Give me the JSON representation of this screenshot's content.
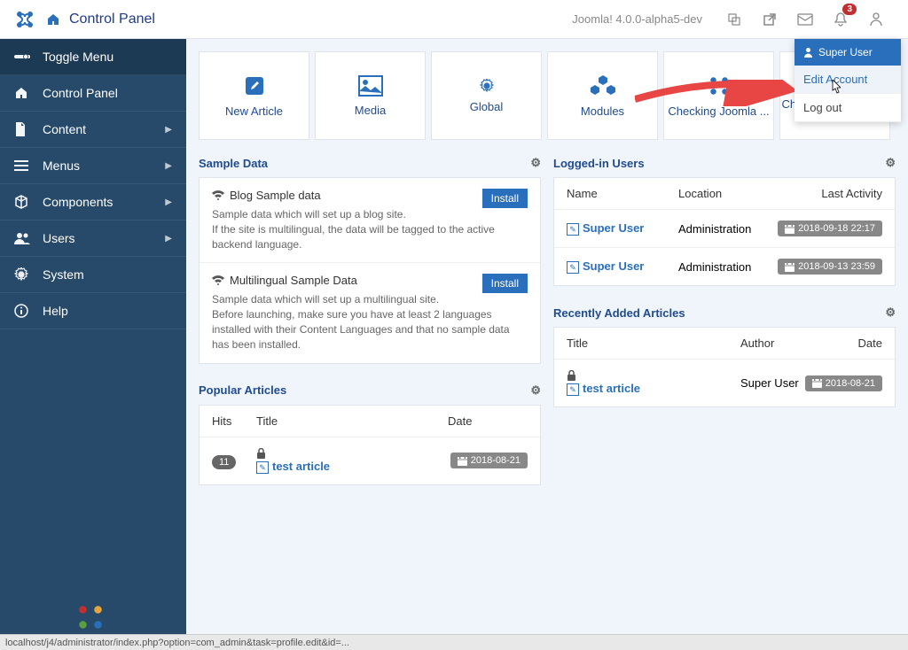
{
  "topbar": {
    "title": "Control Panel",
    "version": "Joomla! 4.0.0-alpha5-dev",
    "notif_count": "3"
  },
  "sidebar": {
    "toggle": "Toggle Menu",
    "items": [
      {
        "icon": "home",
        "label": "Control Panel",
        "arrow": false
      },
      {
        "icon": "file",
        "label": "Content",
        "arrow": true
      },
      {
        "icon": "list",
        "label": "Menus",
        "arrow": true
      },
      {
        "icon": "cube",
        "label": "Components",
        "arrow": true
      },
      {
        "icon": "users",
        "label": "Users",
        "arrow": true
      },
      {
        "icon": "gear",
        "label": "System",
        "arrow": false
      },
      {
        "icon": "info",
        "label": "Help",
        "arrow": false
      }
    ]
  },
  "quick": [
    {
      "icon": "pencil",
      "label": "New Article"
    },
    {
      "icon": "image",
      "label": "Media"
    },
    {
      "icon": "gear",
      "label": "Global"
    },
    {
      "icon": "cubes",
      "label": "Modules"
    },
    {
      "icon": "joomla",
      "label": "Checking Joomla ..."
    },
    {
      "icon": "star",
      "label": "Checking extensions ..."
    }
  ],
  "sample_data": {
    "title": "Sample Data",
    "items": [
      {
        "title": "Blog Sample data",
        "desc": "Sample data which will set up a blog site.\nIf the site is multilingual, the data will be tagged to the active backend language.",
        "install": "Install"
      },
      {
        "title": "Multilingual Sample Data",
        "desc": "Sample data which will set up a multilingual site.\nBefore launching, make sure you have at least 2 languages installed with their Content Languages and that no sample data has been installed.",
        "install": "Install"
      }
    ]
  },
  "logged_in": {
    "title": "Logged-in Users",
    "headers": {
      "name": "Name",
      "location": "Location",
      "activity": "Last Activity"
    },
    "rows": [
      {
        "name": "Super User",
        "location": "Administration",
        "activity": "2018-09-18 22:17"
      },
      {
        "name": "Super User",
        "location": "Administration",
        "activity": "2018-09-13 23:59"
      }
    ]
  },
  "popular": {
    "title": "Popular Articles",
    "headers": {
      "hits": "Hits",
      "title": "Title",
      "date": "Date"
    },
    "rows": [
      {
        "hits": "11",
        "title": "test article",
        "date": "2018-08-21"
      }
    ]
  },
  "recent": {
    "title": "Recently Added Articles",
    "headers": {
      "title": "Title",
      "author": "Author",
      "date": "Date"
    },
    "rows": [
      {
        "title": "test article",
        "author": "Super User",
        "date": "2018-08-21"
      }
    ]
  },
  "user_menu": {
    "header": "Super User",
    "edit": "Edit Account",
    "logout": "Log out"
  },
  "statusbar": "localhost/j4/administrator/index.php?option=com_admin&task=profile.edit&id=..."
}
